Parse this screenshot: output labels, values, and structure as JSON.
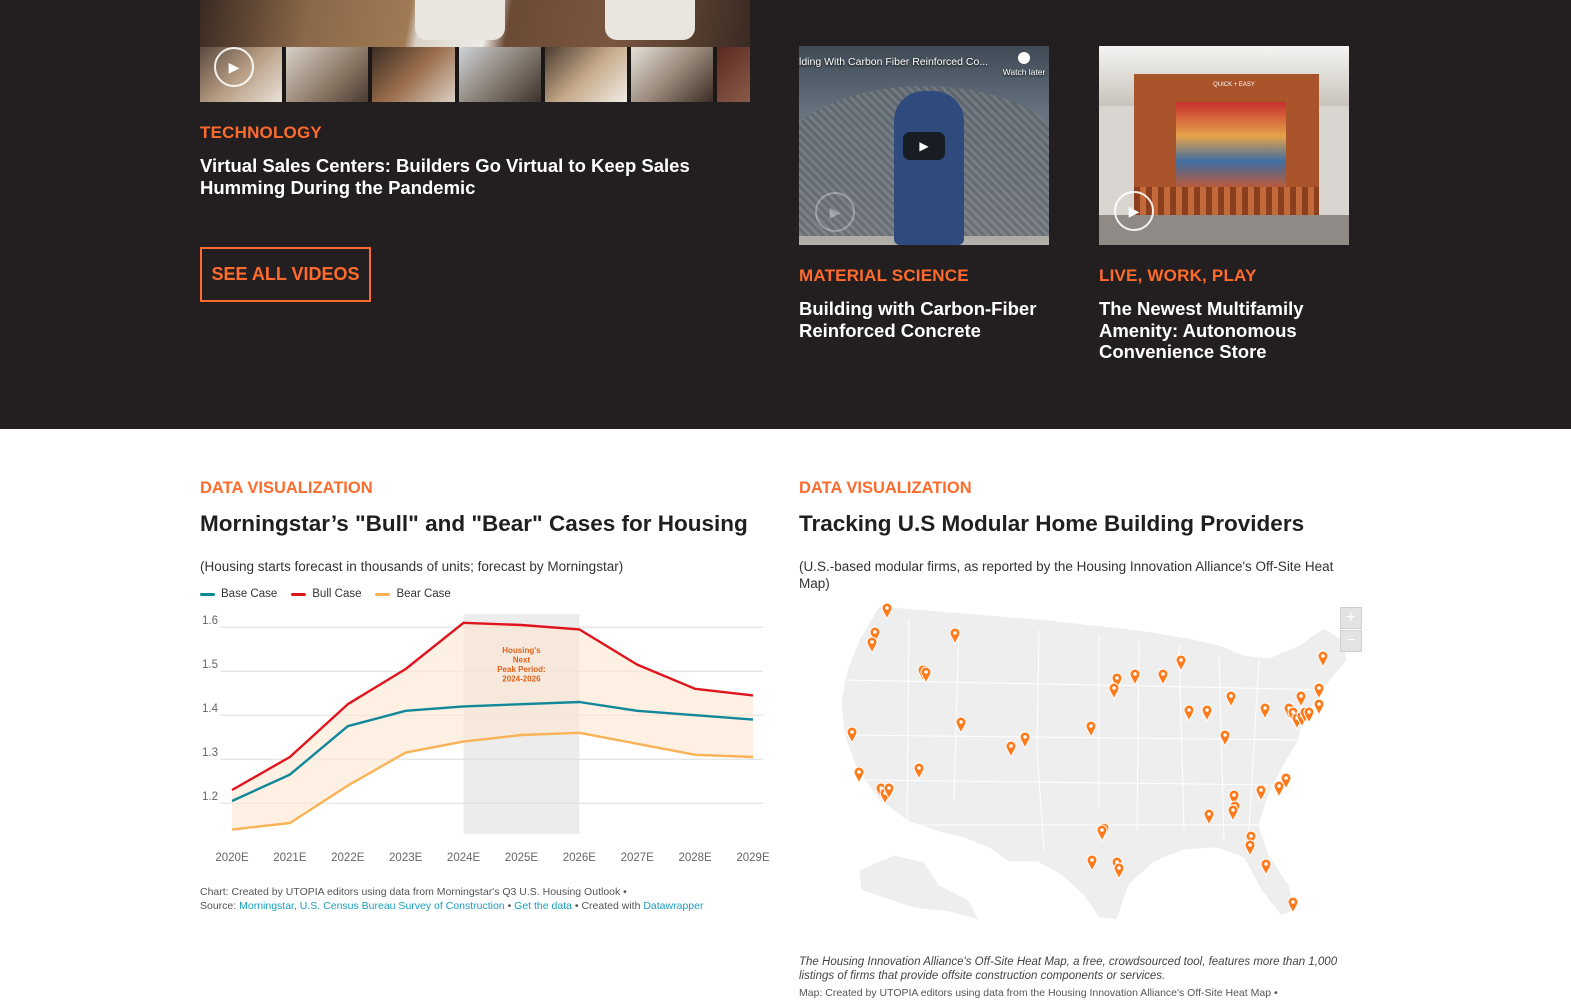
{
  "videos": {
    "featured": {
      "category": "TECHNOLOGY",
      "title": "Virtual Sales Centers: Builders Go Virtual to Keep Sales Humming During the Pandemic"
    },
    "see_all_label": "SEE ALL VIDEOS",
    "cards": [
      {
        "category": "MATERIAL SCIENCE",
        "title": "Building with Carbon-Fiber Reinforced Concrete",
        "embed_title": "lding With Carbon Fiber Reinforced Co...",
        "watch_later": "Watch later"
      },
      {
        "category": "LIVE, WORK, PLAY",
        "title": "The Newest Multifamily Amenity: Autonomous Convenience Store",
        "sign_text": "QUICK + EASY"
      }
    ]
  },
  "housing_chart": {
    "kicker": "DATA VISUALIZATION",
    "title": "Morningstar’s \"Bull\" and \"Bear\" Cases for Housing",
    "subtitle": "(Housing starts forecast in thousands of units; forecast by Morningstar)",
    "credit_prefix": "Chart: Created by UTOPIA editors using data from Morningstar's Q3 U.S. Housing Outlook •",
    "credit_source_label": "Source:",
    "credit_source_link": "Morningstar, U.S. Census Bureau Survey of Construction",
    "credit_sep1": " • ",
    "credit_get_data": "Get the data",
    "credit_sep2": " • Created with ",
    "credit_datawrapper": "Datawrapper"
  },
  "chart_data": {
    "type": "line",
    "x": [
      "2020E",
      "2021E",
      "2022E",
      "2023E",
      "2024E",
      "2025E",
      "2026E",
      "2027E",
      "2028E",
      "2029E"
    ],
    "ylim": [
      1.13,
      1.63
    ],
    "yticks": [
      1.2,
      1.3,
      1.4,
      1.5,
      1.6
    ],
    "grid": true,
    "legend_position": "top-left",
    "series": [
      {
        "name": "Base Case",
        "color": "#11889a",
        "values": [
          1.205,
          1.265,
          1.375,
          1.41,
          1.42,
          1.425,
          1.43,
          1.41,
          1.4,
          1.39
        ]
      },
      {
        "name": "Bull Case",
        "color": "#e0141d",
        "values": [
          1.23,
          1.305,
          1.425,
          1.505,
          1.61,
          1.605,
          1.595,
          1.515,
          1.46,
          1.445
        ]
      },
      {
        "name": "Bear Case",
        "color": "#f9b356",
        "values": [
          1.14,
          1.155,
          1.24,
          1.315,
          1.34,
          1.355,
          1.36,
          1.335,
          1.31,
          1.305
        ]
      }
    ],
    "band": {
      "lower": "Bear Case",
      "upper": "Bull Case",
      "color": "#fde6d0"
    },
    "highlight": {
      "from": "2024E",
      "to": "2026E",
      "color": "#ececec",
      "label": [
        "Housing's",
        "Next",
        "Peak Period:",
        "2024-2026"
      ],
      "label_color": "#e0611d"
    }
  },
  "map_section": {
    "kicker": "DATA VISUALIZATION",
    "title": "Tracking U.S Modular Home Building Providers",
    "subtitle": "(U.S.-based modular firms, as reported by the Housing Innovation Alliance's Off-Site Heat Map)",
    "zoom_in": "+",
    "zoom_out": "−",
    "caption": "The Housing Innovation Alliance's Off-Site Heat Map, a free, crowdsourced tool, features more than 1,000 listings of firms that provide offsite construction components or services.",
    "credit": "Map: Created by UTOPIA editors using data from the Housing Innovation Alliance's Off-Site Heat Map •",
    "marker_color": "#ff7a1a"
  }
}
